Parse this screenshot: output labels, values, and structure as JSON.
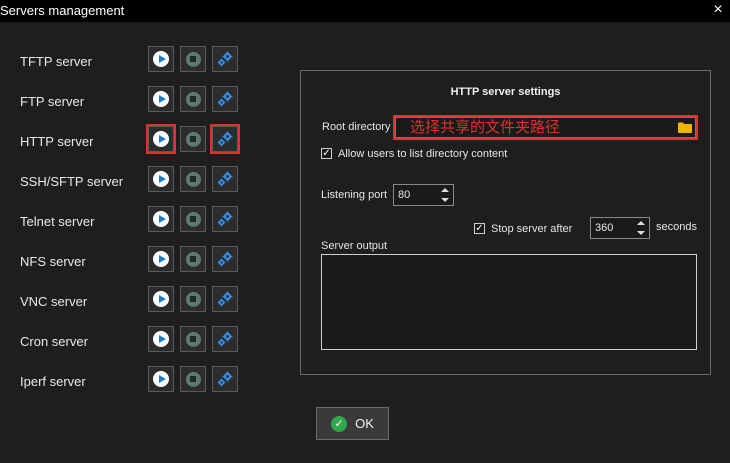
{
  "window": {
    "title": "Servers management",
    "close_glyph": "×"
  },
  "servers": [
    {
      "label": "TFTP server"
    },
    {
      "label": "FTP server"
    },
    {
      "label": "HTTP server",
      "highlighted": true
    },
    {
      "label": "SSH/SFTP server"
    },
    {
      "label": "Telnet server"
    },
    {
      "label": "NFS server"
    },
    {
      "label": "VNC server"
    },
    {
      "label": "Cron server"
    },
    {
      "label": "Iperf server"
    }
  ],
  "settings": {
    "title": "HTTP server settings",
    "root_directory_label": "Root directory",
    "root_directory_value": "选择共享的文件夹路径",
    "allow_list_label": "Allow users to list directory content",
    "allow_list_checked": true,
    "listening_port_label": "Listening port",
    "listening_port_value": "80",
    "stop_after_label": "Stop server after",
    "stop_after_checked": true,
    "stop_after_value": "360",
    "seconds_label": "seconds",
    "server_output_label": "Server output",
    "server_output_value": ""
  },
  "footer": {
    "ok_label": "OK"
  },
  "colors": {
    "accent_play": "#1a7fd6",
    "highlight_red": "#e0312b",
    "ok_green": "#2fa84a",
    "folder_yellow": "#f0b400"
  },
  "icons": {
    "start": "play-icon",
    "stop": "stop-icon",
    "settings": "gear-icon",
    "folder": "folder-icon",
    "ok": "check-icon"
  }
}
